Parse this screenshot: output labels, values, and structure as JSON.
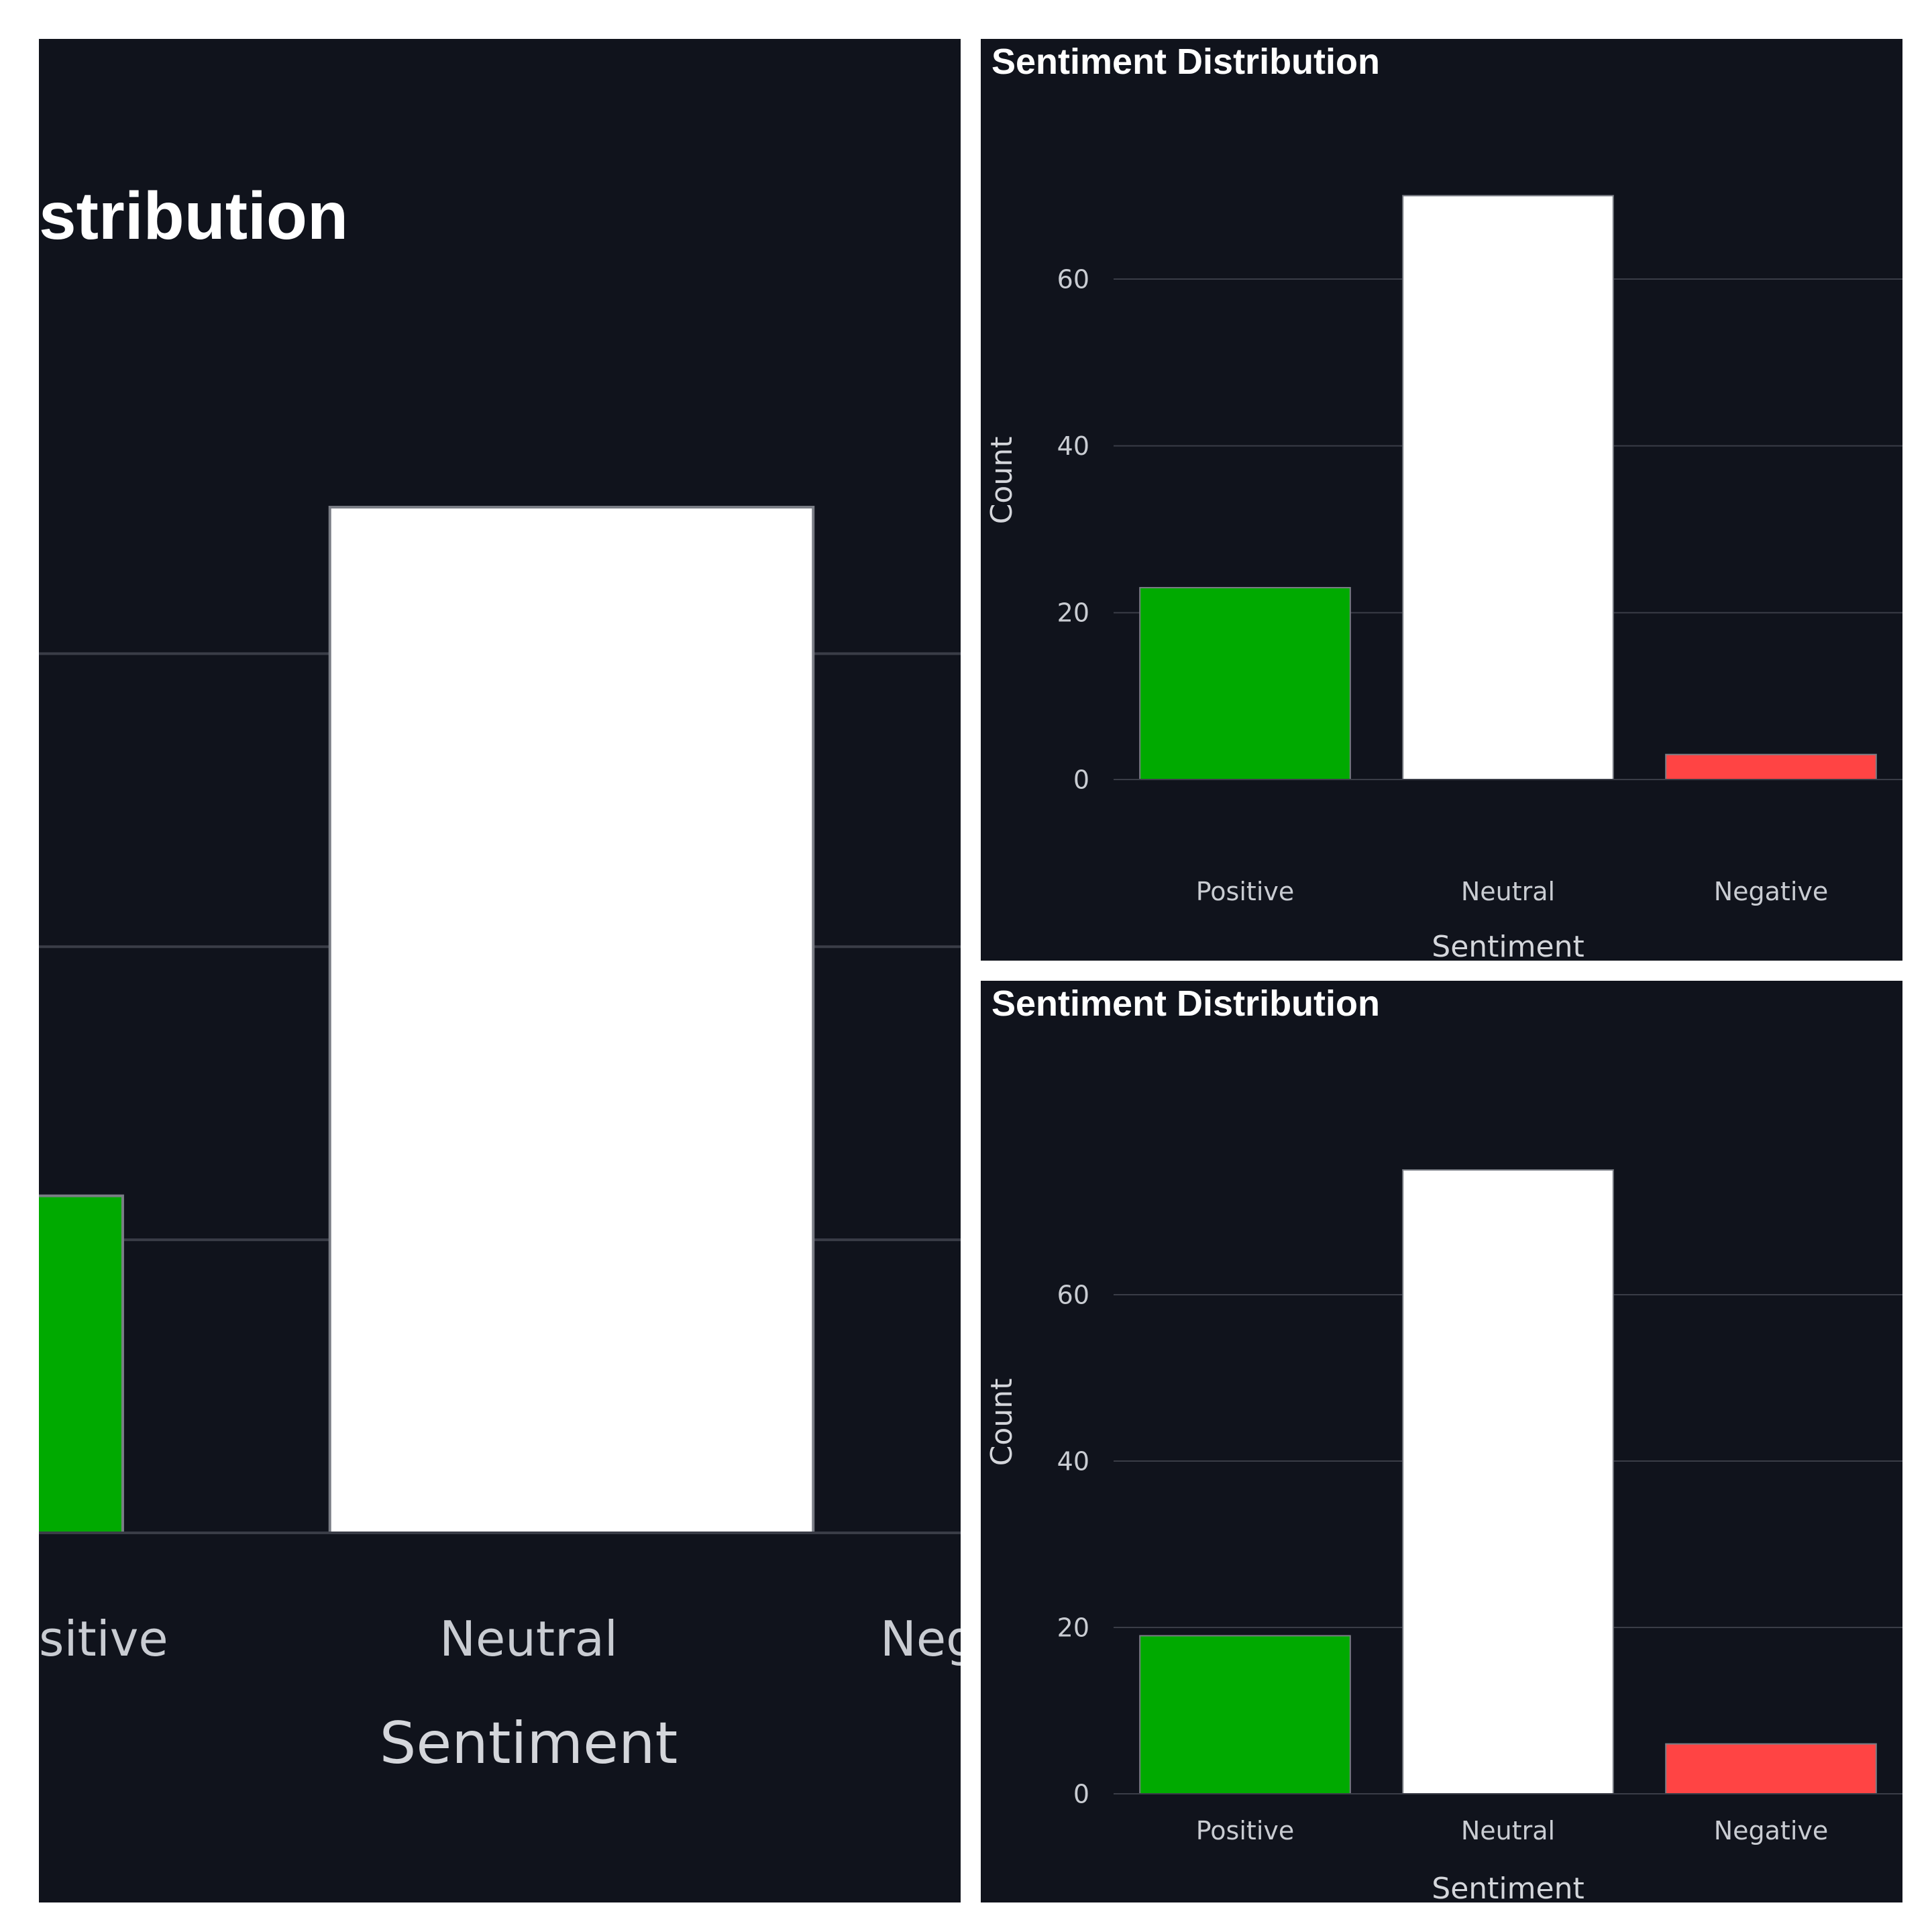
{
  "colors": {
    "background": "#10131c",
    "gridline": "#3a3d47",
    "text": "#ffffff",
    "tick_text": "#c9ccd2"
  },
  "chart_data": [
    {
      "panel": "left-zoomed",
      "type": "bar",
      "title": "Sentiment Distribution",
      "visible_title_fragment": "stribution",
      "xlabel": "Sentiment",
      "ylabel": "",
      "categories": [
        "Positive",
        "Neutral",
        "Negative"
      ],
      "visible_category_fragments": [
        "sitive",
        "Neutral",
        "Neg"
      ],
      "values": [
        23,
        70,
        3
      ],
      "colors": [
        "#00aa00",
        "#ffffff",
        "#ff4444"
      ],
      "ylim": [
        0,
        70
      ],
      "yticks": [
        0,
        20,
        40,
        60
      ],
      "grid": true,
      "legend": false
    },
    {
      "panel": "top-right",
      "type": "bar",
      "title": "Sentiment Distribution",
      "xlabel": "Sentiment",
      "ylabel": "Count",
      "categories": [
        "Positive",
        "Neutral",
        "Negative"
      ],
      "values": [
        23,
        70,
        3
      ],
      "colors": [
        "#00aa00",
        "#ffffff",
        "#ff4444"
      ],
      "ylim": [
        0,
        70
      ],
      "yticks": [
        0,
        20,
        40,
        60
      ],
      "grid": true,
      "legend": false
    },
    {
      "panel": "bottom-right",
      "type": "bar",
      "title": "Sentiment Distribution",
      "xlabel": "Sentiment",
      "ylabel": "Count",
      "categories": [
        "Positive",
        "Neutral",
        "Negative"
      ],
      "values": [
        19,
        75,
        6
      ],
      "colors": [
        "#00aa00",
        "#ffffff",
        "#ff4444"
      ],
      "ylim": [
        0,
        75
      ],
      "yticks": [
        0,
        20,
        40,
        60
      ],
      "grid": true,
      "legend": false
    }
  ]
}
